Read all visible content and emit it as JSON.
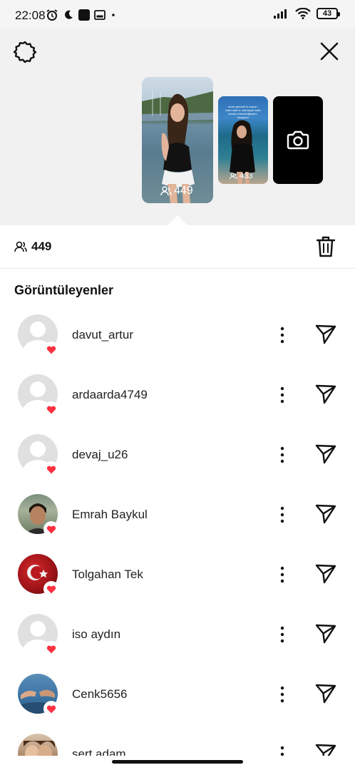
{
  "status_bar": {
    "time": "22:08",
    "battery": "43",
    "icons": [
      "alarm-icon",
      "moon-icon",
      "app-icon",
      "media-icon",
      "dot-icon",
      "signal-icon",
      "wifi-icon",
      "battery-icon"
    ]
  },
  "header": {
    "left_icon": "gear-icon",
    "right_icon": "close-icon"
  },
  "stories": [
    {
      "viewers": "449",
      "selected": true
    },
    {
      "viewers": "433",
      "selected": false,
      "caption": "sevdi gelmedi ki kaçan ı kaldı sabrın, kalmayan kalbi tahmin edemediğinden, kavgasın"
    },
    {
      "icon": "camera-icon"
    }
  ],
  "info_bar": {
    "viewers_total": "449",
    "delete_icon": "trash-icon"
  },
  "viewers_section": {
    "title": "Görüntüleyenler",
    "viewers": [
      {
        "username": "davut_artur",
        "avatar": "default",
        "liked": true
      },
      {
        "username": "ardaarda4749",
        "avatar": "default",
        "liked": true
      },
      {
        "username": "devaj_u26",
        "avatar": "default",
        "liked": true
      },
      {
        "username": "Emrah Baykul",
        "avatar": "photo",
        "liked": true
      },
      {
        "username": "Tolgahan Tek",
        "avatar": "photo",
        "liked": true
      },
      {
        "username": "iso aydın",
        "avatar": "default",
        "liked": true
      },
      {
        "username": "Cenk5656",
        "avatar": "photo",
        "liked": true
      },
      {
        "username": "sert adam",
        "avatar": "photo",
        "liked": false
      }
    ]
  },
  "colors": {
    "accent_like": "#ff3040",
    "background": "#ffffff",
    "story_area": "#f1f1f1"
  }
}
